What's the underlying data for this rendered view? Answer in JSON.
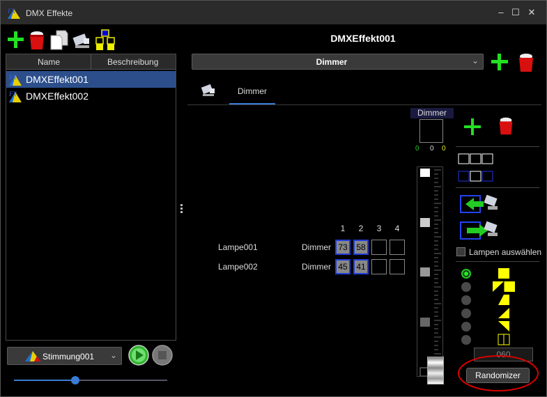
{
  "window": {
    "title": "DMX Effekte",
    "controls": {
      "minimize": "–",
      "maximize": "☐",
      "close": "✕"
    }
  },
  "toolbar": {
    "items": [
      {
        "icon": "add-icon"
      },
      {
        "icon": "delete-bucket-icon"
      },
      {
        "icon": "copy-icon"
      },
      {
        "icon": "device-icon"
      },
      {
        "icon": "grid-icon"
      }
    ]
  },
  "effect_list": {
    "columns": [
      "Name",
      "Beschreibung"
    ],
    "rows": [
      {
        "name": "DMXEffekt001",
        "selected": true
      },
      {
        "name": "DMXEffekt002",
        "selected": false
      }
    ]
  },
  "bottom_left": {
    "scene_select": "Stimmung001",
    "slider_value_percent": 40
  },
  "header": {
    "effect_name": "DMXEffekt001"
  },
  "effect_type": {
    "selected": "Dimmer"
  },
  "tabs": [
    {
      "label": "Dimmer",
      "active": true
    }
  ],
  "fader": {
    "title": "Dimmer",
    "values": [
      "0",
      "0",
      "0"
    ],
    "value_colors": [
      "#22cc22",
      "#dddddd",
      "#e6e62a"
    ]
  },
  "channel_headers": [
    "1",
    "2",
    "3",
    "4"
  ],
  "lamps": [
    {
      "name": "Lampe001",
      "type": "Dimmer",
      "values": [
        "73",
        "58",
        "",
        ""
      ]
    },
    {
      "name": "Lampe002",
      "type": "Dimmer",
      "values": [
        "45",
        "41",
        "",
        ""
      ]
    }
  ],
  "right_panel": {
    "select_lamps_label": "Lampen auswählen",
    "number_field": "060",
    "randomizer_label": "Randomizer"
  },
  "colors": {
    "selection_blue": "#2c4f8c",
    "cell_border_blue": "#1f3bd8",
    "pattern_yellow": "#ffff00",
    "highlight_red": "#d80000"
  }
}
